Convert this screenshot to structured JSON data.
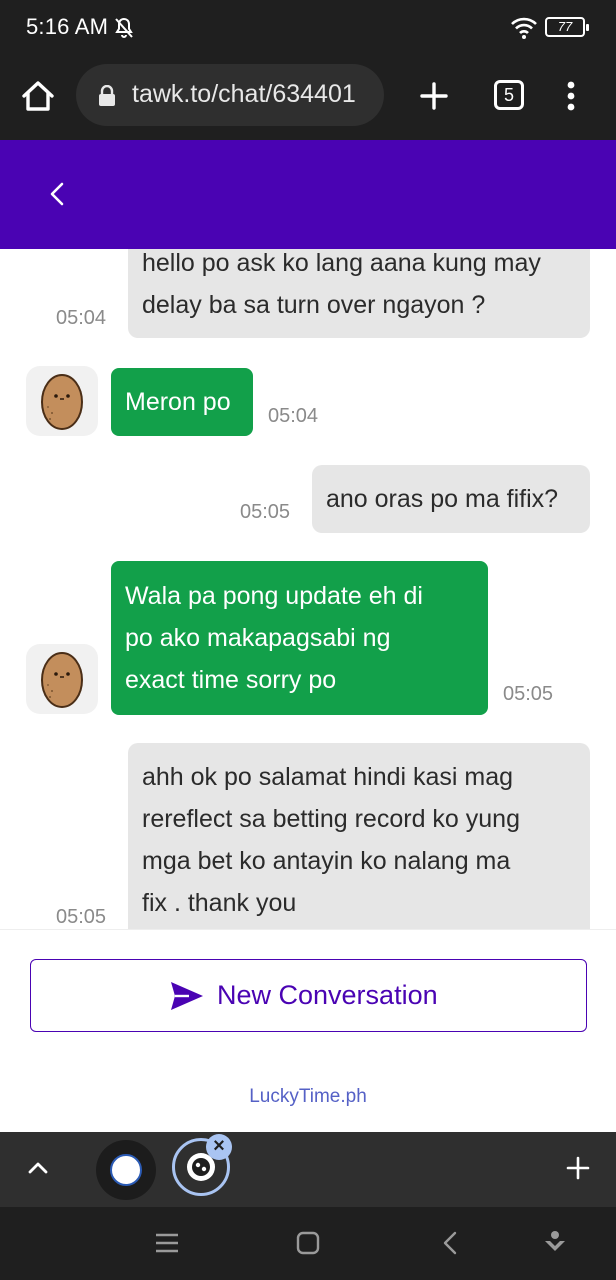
{
  "status_bar": {
    "time": "5:16 AM",
    "battery": "77",
    "icons": [
      "muted-bell-icon",
      "wifi-icon",
      "battery-icon"
    ]
  },
  "browser": {
    "url": "tawk.to/chat/634401",
    "tab_count": "5",
    "icons": [
      "home-icon",
      "lock-icon",
      "plus-icon",
      "tabs-icon",
      "more-vert-icon"
    ]
  },
  "chat": {
    "header_color": "#4a03b3",
    "messages": [
      {
        "sender": "visitor",
        "lines": [
          "hello po ask ko lang aana kung may",
          "delay ba sa turn over ngayon ?"
        ],
        "time": "05:04"
      },
      {
        "sender": "agent",
        "lines": [
          "Meron po"
        ],
        "time": "05:04"
      },
      {
        "sender": "visitor",
        "lines": [
          "ano oras po ma fifix?"
        ],
        "time": "05:05"
      },
      {
        "sender": "agent",
        "lines": [
          "Wala pa pong update eh di",
          "po ako makapagsabi ng",
          "exact time sorry po"
        ],
        "time": "05:05"
      },
      {
        "sender": "visitor",
        "lines": [
          "ahh ok po salamat hindi kasi mag",
          "rereflect sa betting record ko yung",
          "mga bet ko antayin ko nalang ma",
          "fix . thank you"
        ],
        "time": "05:05"
      }
    ],
    "colors": {
      "agent_bubble": "#12a04a",
      "visitor_bubble": "#e6e6e6"
    }
  },
  "footer": {
    "new_conversation_label": "New Conversation",
    "brand": "LuckyTime.ph"
  },
  "tab_strip": {
    "icons": [
      "chevron-up-icon",
      "tab-favicon",
      "tab-favicon-active",
      "close-icon",
      "plus-icon"
    ],
    "close_glyph": "×"
  },
  "nav_bar": {
    "icons": [
      "menu-icon",
      "home-square-icon",
      "back-icon",
      "assistant-icon"
    ]
  }
}
